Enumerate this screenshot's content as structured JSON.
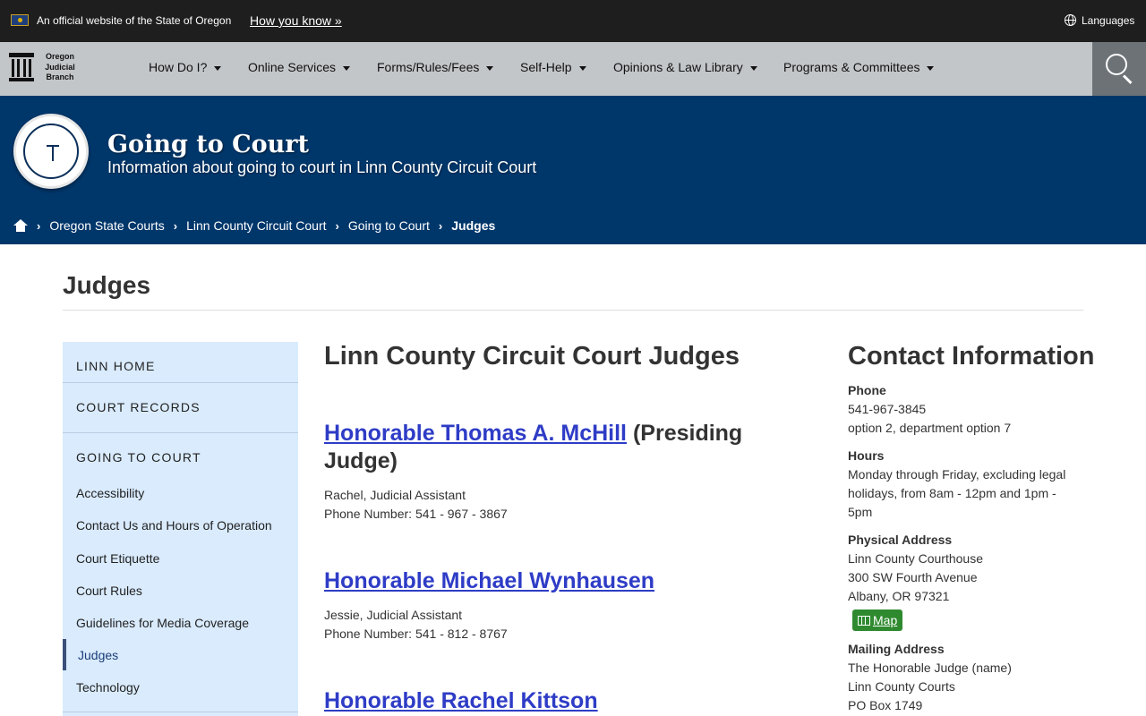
{
  "banner": {
    "official_text": "An official website of the State of Oregon",
    "how_you_know": "How you know »",
    "languages": "Languages"
  },
  "logo": {
    "line1": "Oregon",
    "line2": "Judicial",
    "line3": "Branch"
  },
  "nav": {
    "items": [
      "How Do I?",
      "Online Services",
      "Forms/Rules/Fees",
      "Self-Help",
      "Opinions & Law Library",
      "Programs & Committees"
    ]
  },
  "hero": {
    "title": "Going to Court",
    "subtitle": "Information about going to court in Linn County Circuit Court"
  },
  "breadcrumb": [
    "Oregon State Courts",
    "Linn County Circuit Court",
    "Going to Court",
    "Judges"
  ],
  "page": {
    "title": "Judges"
  },
  "sidebar": {
    "heading1": "LINN HOME",
    "heading2": "COURT RECORDS",
    "heading3": "GOING TO COURT",
    "links": [
      "Accessibility",
      "Contact Us and Hours of Operation",
      "Court Etiquette",
      "Court Rules",
      "Guidelines for Media Coverage",
      "Judges",
      "Technology"
    ]
  },
  "main": {
    "title": "Linn County Circuit Court Judges",
    "judges": [
      {
        "name": "Honorable Thomas A. McHill",
        "suffix": " (Presiding Judge)",
        "assistant": "Rachel, Judicial Assistant",
        "phone": "Phone Number: 541 - 967 - 3867"
      },
      {
        "name": "Honorable Michael Wynhausen",
        "suffix": "",
        "assistant": "Jessie, Judicial Assistant",
        "phone": "Phone Number: 541 - 812 - 8767"
      },
      {
        "name": "Honorable Rachel Kittson",
        "suffix": "",
        "assistant": "",
        "phone": ""
      }
    ]
  },
  "contact": {
    "title": "Contact Information",
    "phone_label": "Phone",
    "phone": "541-967-3845",
    "phone_note": "option 2, department option 7",
    "hours_label": "Hours",
    "hours": "Monday through Friday, excluding legal holidays, from 8am - 12pm and 1pm - 5pm",
    "physical_label": "Physical Address",
    "physical1": "Linn County Courthouse",
    "physical2": "300 SW Fourth Avenue",
    "physical3": "Albany, OR 97321",
    "map": "Map",
    "mailing_label": "Mailing Address",
    "mailing1": "The Honorable Judge (name)",
    "mailing2": "Linn County Courts",
    "mailing3": "PO Box 1749"
  },
  "colors": {
    "banner_bg": "#1e1e1e",
    "nav_bg": "#c3c6c9",
    "hero_bg": "#00376b",
    "sidebar_bg": "#d9ebfd",
    "link": "#2e3cc6",
    "map_button": "#2f8a2f"
  }
}
